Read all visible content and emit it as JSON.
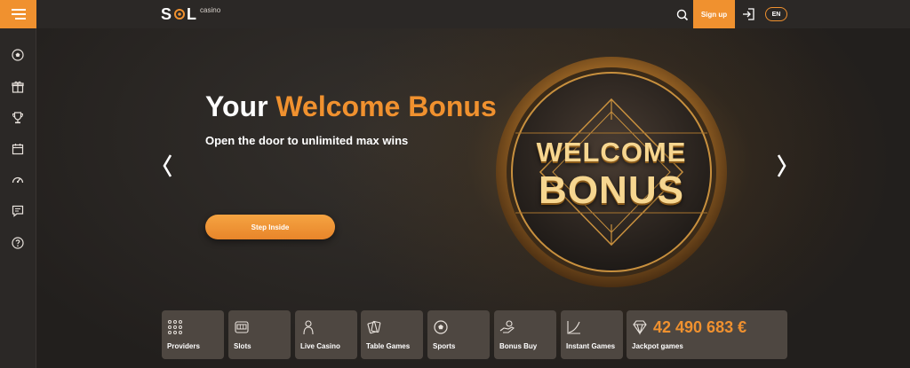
{
  "header": {
    "logo_text": "SOL",
    "logo_sub": "casino",
    "signup_label": "Sign up",
    "language": "EN",
    "accent_color": "#f0912f"
  },
  "sidebar": {
    "icons": [
      "soccer-ball-icon",
      "gift-icon",
      "trophy-icon",
      "calendar-icon",
      "speedometer-icon",
      "chat-icon",
      "help-icon"
    ]
  },
  "hero": {
    "title_white": "Your ",
    "title_accent": "Welcome Bonus",
    "subtitle": "Open the door to unlimited max wins",
    "cta_label": "Step Inside",
    "coin_line1": "WELCOME",
    "coin_line2": "BONUS"
  },
  "categories": [
    {
      "label": "Providers",
      "icon": "grid-dots-icon"
    },
    {
      "label": "Slots",
      "icon": "slot-machine-icon"
    },
    {
      "label": "Live Casino",
      "icon": "dealer-icon"
    },
    {
      "label": "Table Games",
      "icon": "cards-icon"
    },
    {
      "label": "Sports",
      "icon": "soccer-ball-icon"
    },
    {
      "label": "Bonus Buy",
      "icon": "hand-coin-icon"
    },
    {
      "label": "Instant Games",
      "icon": "chart-rising-icon"
    }
  ],
  "jackpot": {
    "amount": "42 490 683 €",
    "label": "Jackpot games",
    "icon": "diamond-icon"
  }
}
